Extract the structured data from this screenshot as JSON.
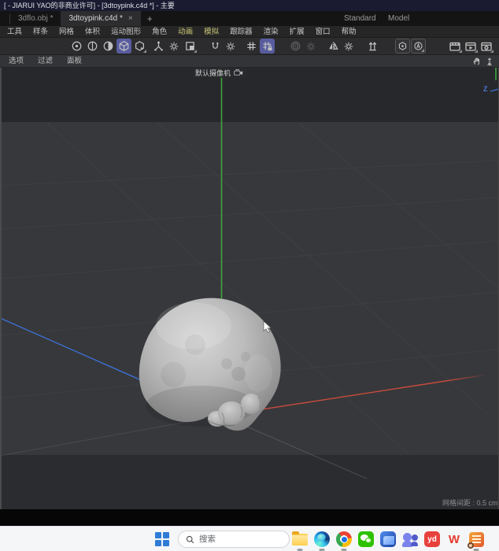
{
  "window": {
    "title": "[ - JIARUI YAO的非商业许可]  - [3dtoypink.c4d *] - 主要"
  },
  "tabbar": {
    "tabs": [
      {
        "label": "3dflo.obj *",
        "active": false
      },
      {
        "label": "3dtoypink.c4d *",
        "active": true
      }
    ],
    "close_label": "×",
    "new_tab_label": "+",
    "layout_left": "Standard",
    "layout_right": "Model"
  },
  "menubar": {
    "items": [
      {
        "label": "工具"
      },
      {
        "label": "样条"
      },
      {
        "label": "网格"
      },
      {
        "label": "体积"
      },
      {
        "label": "运动图形"
      },
      {
        "label": "角色"
      },
      {
        "label": "动画",
        "highlighted": true
      },
      {
        "label": "模拟",
        "highlighted": true
      },
      {
        "label": "跟踪器"
      },
      {
        "label": "渲染"
      },
      {
        "label": "扩展"
      },
      {
        "label": "窗口"
      },
      {
        "label": "帮助"
      }
    ],
    "highlight_color": "#ccc879"
  },
  "toolbar": {
    "selected_bg": "#585c9f",
    "groups": [
      {
        "icons": [
          {
            "name": "points-mode",
            "selected": false
          },
          {
            "name": "edges-mode",
            "selected": false
          },
          {
            "name": "polygons-mode",
            "selected": false
          },
          {
            "name": "model-mode",
            "selected": true
          },
          {
            "name": "texture-axis-mode",
            "selected": false
          }
        ]
      },
      {
        "icons": [
          {
            "name": "axis-modification"
          },
          {
            "name": "axis-settings-gear"
          },
          {
            "name": "workplane"
          }
        ]
      },
      {
        "icons": [
          {
            "name": "snap"
          },
          {
            "name": "snap-settings-gear"
          }
        ]
      },
      {
        "icons": [
          {
            "name": "quantize-grid"
          },
          {
            "name": "quantize-grid-lock",
            "selected": true
          }
        ]
      },
      {
        "icons": [
          {
            "name": "falloff",
            "disabled": true
          },
          {
            "name": "falloff-settings-gear",
            "disabled": true
          }
        ]
      },
      {
        "icons": [
          {
            "name": "symmetry"
          },
          {
            "name": "symmetry-settings-gear"
          }
        ]
      },
      {
        "icons": [
          {
            "name": "normal-move"
          }
        ]
      },
      {
        "icons": [
          {
            "name": "modeling-kernel"
          },
          {
            "name": "auto-mode"
          }
        ]
      },
      {
        "icons": [
          {
            "name": "render-view"
          },
          {
            "name": "render-to-picture-viewer"
          },
          {
            "name": "render-settings"
          }
        ]
      }
    ]
  },
  "viewport_menu": {
    "items": [
      {
        "label": "选项"
      },
      {
        "label": "过滤"
      },
      {
        "label": "面板"
      }
    ],
    "nav_icons": [
      {
        "name": "pan-hand"
      },
      {
        "name": "dolly"
      }
    ]
  },
  "viewport": {
    "camera_label": "默认摄像机",
    "grid_spacing_label": "网格间距 : 0.5 cm",
    "gizmo_z_label": "Z",
    "axis_colors": {
      "x": "#c84b3c",
      "y": "#3fa43f",
      "z": "#3c6fd0"
    },
    "model": "gray-scanned-toy-blob"
  },
  "taskbar": {
    "search_placeholder": "搜索",
    "youdao_label": "yd",
    "wps_label": "W",
    "apps": [
      {
        "name": "file-explorer",
        "running": true
      },
      {
        "name": "edge-browser",
        "running": true
      },
      {
        "name": "chrome-browser",
        "running": true
      },
      {
        "name": "wechat",
        "running": false
      },
      {
        "name": "blue-app",
        "running": false
      },
      {
        "name": "teams",
        "running": false
      },
      {
        "name": "youdao-dict",
        "running": false
      },
      {
        "name": "wps-office",
        "running": false
      },
      {
        "name": "document-reader",
        "running": true
      }
    ]
  }
}
